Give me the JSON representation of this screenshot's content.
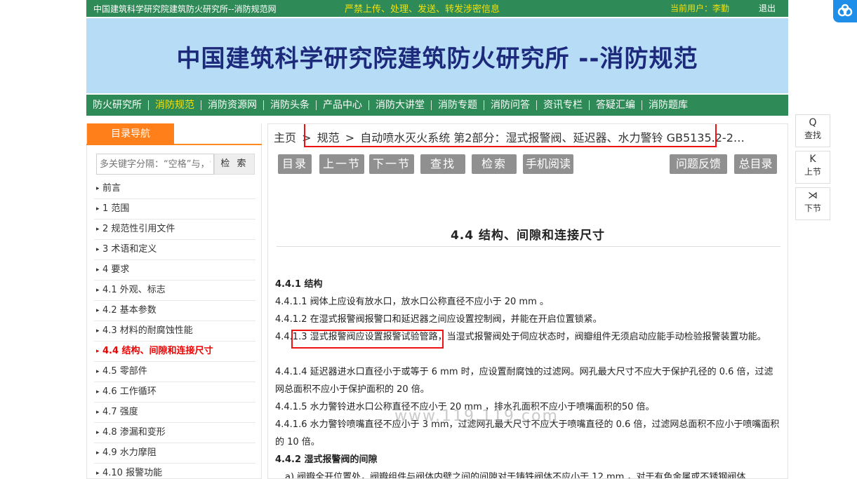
{
  "topbar": {
    "site_name": "中国建筑科学研究院建筑防火研究所--消防规范网",
    "warning": "严禁上传、处理、发送、转发涉密信息",
    "current_user": "当前用户：李勤",
    "logout": "退出"
  },
  "banner": {
    "title": "中国建筑科学研究院建筑防火研究所 --消防规范"
  },
  "nav": {
    "items": [
      "防火研究所",
      "消防规范",
      "消防资源网",
      "消防头条",
      "产品中心",
      "消防大讲堂",
      "消防专题",
      "消防问答",
      "资讯专栏",
      "答疑汇编",
      "消防题库"
    ],
    "active_index": 1
  },
  "sidebar": {
    "tab_label": "目录导航",
    "search_placeholder": "多关键字分隔：“空格”与，“\\",
    "search_button": "检 索",
    "toc": [
      "前言",
      "1 范围",
      "2 规范性引用文件",
      "3 术语和定义",
      "4 要求",
      "4.1 外观、标志",
      "4.2 基本参数",
      "4.3 材料的耐腐蚀性能",
      "4.4 结构、间隙和连接尺寸",
      "4.5 零部件",
      "4.6 工作循环",
      "4.7 强度",
      "4.8 渗漏和变形",
      "4.9 水力摩阻",
      "4.10 报警功能"
    ],
    "active_index": 8
  },
  "content": {
    "breadcrumb": {
      "home": "主页",
      "sep": ">",
      "section": "规范",
      "standard": "自动喷水灭火系统 第2部分：湿式报警阀、延迟器、水力警铃 GB5135.2-2…"
    },
    "buttons": {
      "toc": "目录",
      "prev": "上一节",
      "next": "下一节",
      "find": "查找",
      "search": "检索",
      "mobile": "手机阅读",
      "feedback": "问题反馈",
      "all_toc": "总目录"
    },
    "section_title": "4.4 结构、间隙和连接尺寸",
    "paragraphs": [
      "4.4.1 结构",
      "4.4.1.1 阀体上应设有放水口，放水口公称直径不应小于 20 mm 。",
      "4.4.1.2 在湿式报警阀报警口和延迟器之间应设置控制阀，并能在开启位置锁紧。",
      "4.4.1.3 湿式报警阀应设置报警试验管路，当湿式报警阀处于伺应状态时，阀瓣组件无须启动应能手动检验报警装置功能。",
      "4.4.1.4 延迟器进水口直径小于或等于 6 mm 时，应设置耐腐蚀的过滤网。网孔最大尺寸不应大于保护孔径的 0.6 倍，过滤网总面积不应小于保护面积的 20 倍。",
      "4.4.1.5 水力警铃进水口公称直径不应小于 20 mm ，排水孔面积不应小于喷嘴面积的50 倍。",
      "4.4.1.6 水力警铃喷嘴直径不应小于 3 mm，过滤网孔最大尺寸不应大于喷嘴直径的 0.6 倍，过滤网总面积不应小于喷嘴面积的 10 倍。",
      "4.4.2 湿式报警阀的间隙",
      "a) 阀瓣全开位置处，阀瓣组件与阀体内壁之间的间隙对于铸铁阀体不应小于 12 mm ，对于有色金属或不锈钢阀体"
    ],
    "watermark": "www.119.119.com"
  },
  "float_panel": [
    {
      "icon": "Q",
      "label": "查找"
    },
    {
      "icon": "K",
      "label": "上节"
    },
    {
      "icon": "⋊",
      "label": "下节"
    }
  ],
  "colors": {
    "green": "#2e8b57",
    "orange": "#ff7f1a",
    "banner_bg": "#b7dcf6",
    "title_blue": "#1d2a7c",
    "highlight": "#e11111",
    "button_gray": "#909090",
    "active_red": "#e00000",
    "nav_active": "#f1e10f"
  }
}
